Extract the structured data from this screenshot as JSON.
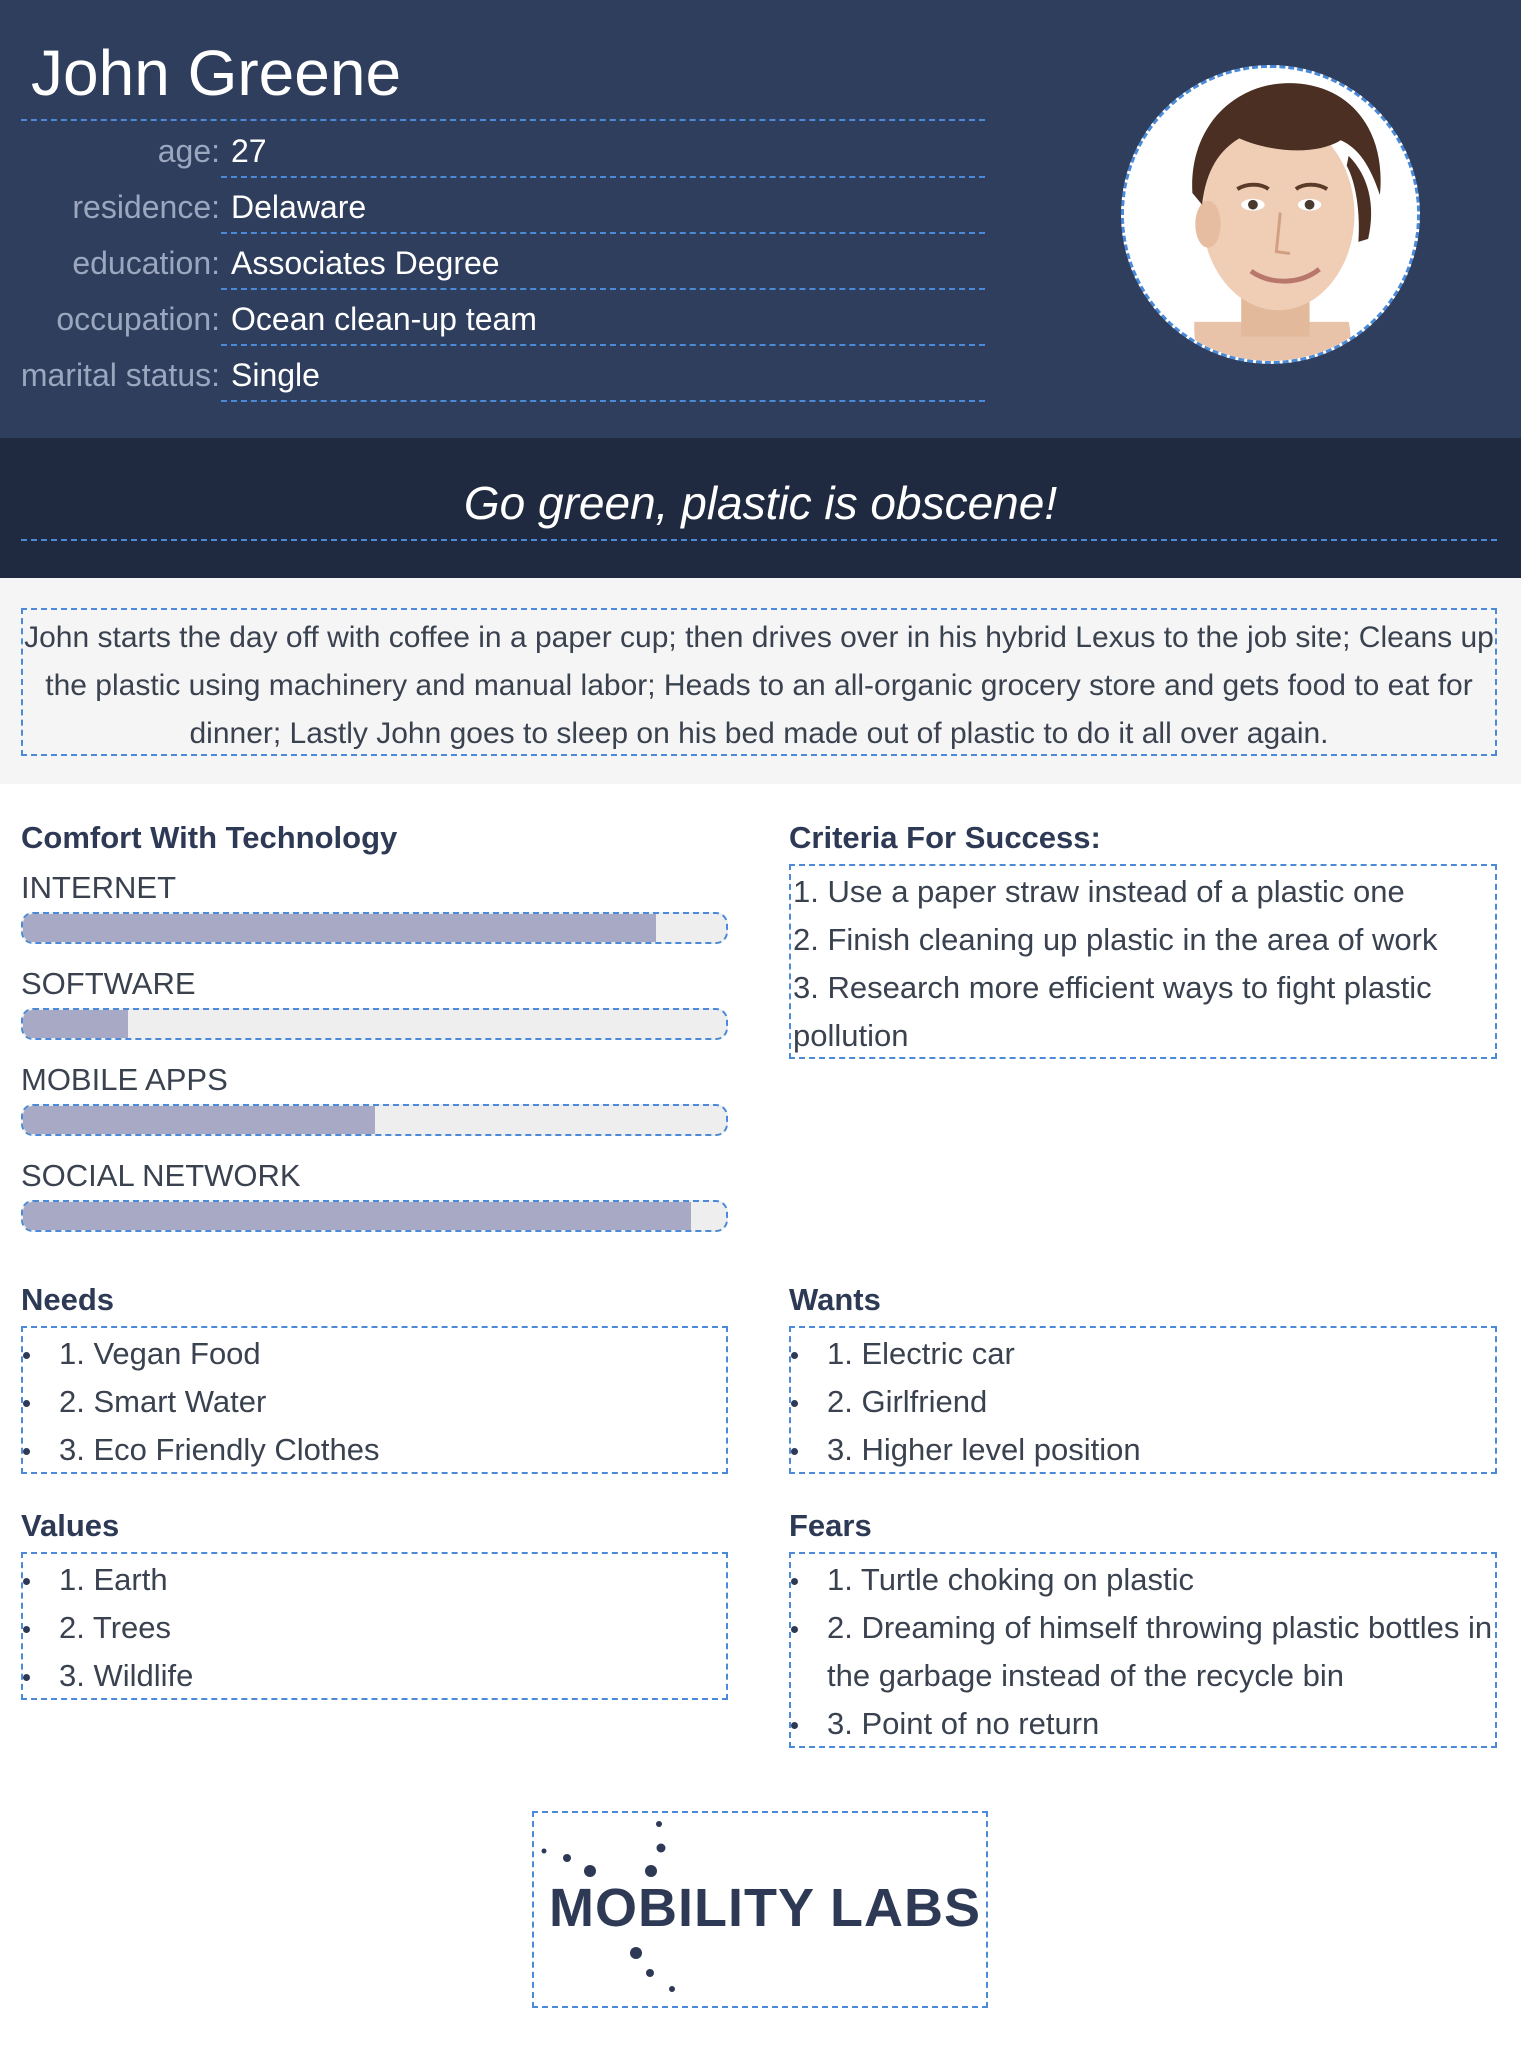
{
  "persona": {
    "name": "John Greene",
    "fields": [
      {
        "label": "age:",
        "value": "27"
      },
      {
        "label": "residence:",
        "value": "Delaware"
      },
      {
        "label": "education:",
        "value": "Associates Degree"
      },
      {
        "label": "occupation:",
        "value": "Ocean clean-up team"
      },
      {
        "label": "marital status:",
        "value": "Single"
      }
    ]
  },
  "quote": "Go green, plastic is obscene!",
  "story": "John starts the day off with coffee in a paper cup; then drives over in his hybrid Lexus to the job site; Cleans up the plastic using machinery and manual labor; Heads to an all-organic grocery store and gets food to eat for dinner; Lastly John goes to sleep on his bed made out of plastic to do it all over again.",
  "technology": {
    "title": "Comfort With Technology",
    "items": [
      {
        "label": "INTERNET",
        "level": 0.9
      },
      {
        "label": "SOFTWARE",
        "level": 0.15
      },
      {
        "label": "MOBILE APPS",
        "level": 0.5
      },
      {
        "label": "SOCIAL NETWORK",
        "level": 0.95
      }
    ]
  },
  "criteria": {
    "title": "Criteria For Success:",
    "items": [
      "1. Use a paper straw instead of a plastic one",
      "2. Finish cleaning up plastic in the area of work",
      "3. Research more efficient ways to fight plastic pollution"
    ]
  },
  "needs": {
    "title": "Needs",
    "items": [
      "1. Vegan Food",
      "2. Smart Water",
      "3. Eco Friendly Clothes"
    ]
  },
  "wants": {
    "title": "Wants",
    "items": [
      "1. Electric car",
      "2. Girlfriend",
      "3. Higher level position"
    ]
  },
  "values": {
    "title": "Values",
    "items": [
      "1. Earth",
      "2. Trees",
      "3. Wildlife"
    ]
  },
  "fears": {
    "title": "Fears",
    "items": [
      "1. Turtle choking on plastic",
      "2. Dreaming of himself throwing plastic bottles in the garbage instead of the recycle bin",
      "3. Point of no return"
    ]
  },
  "logo": {
    "text": "MOBILITY LABS"
  },
  "colors": {
    "header_bg": "#2f3e5d",
    "quote_bg": "#1f2a40",
    "dash_accent": "#4b8ad6",
    "bar_fill": "#a8a9c4",
    "bar_track": "#eeeeef"
  }
}
